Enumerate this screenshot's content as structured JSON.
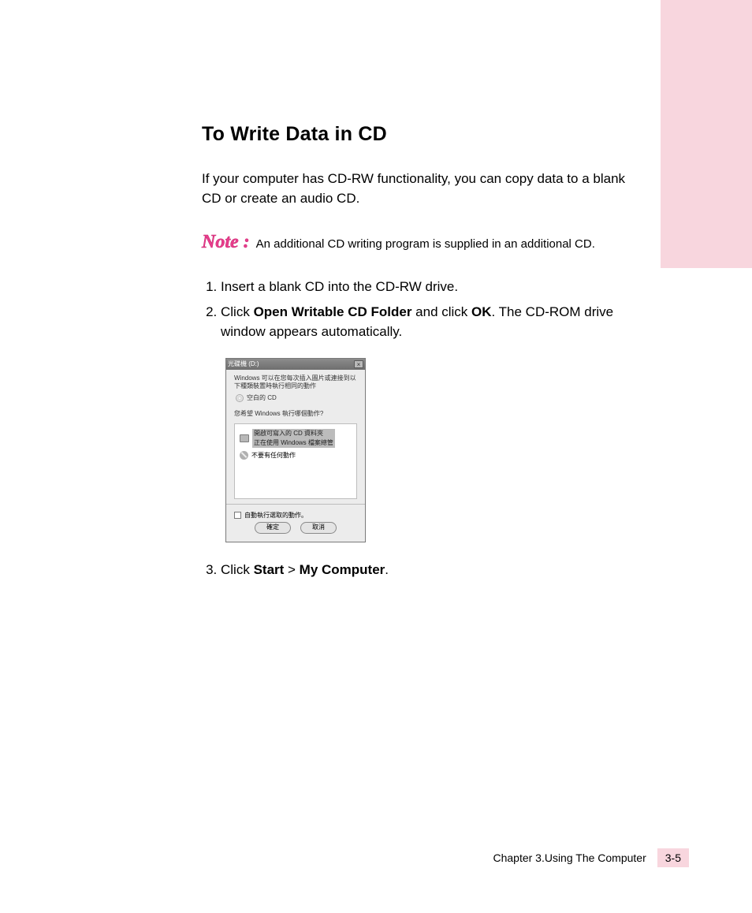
{
  "heading": "To Write Data in CD",
  "intro": "If your computer has CD-RW functionality, you can copy data to a blank CD or create an audio CD.",
  "note": {
    "label": "Note :",
    "text": "An additional CD writing program is supplied in an additional CD."
  },
  "steps": {
    "s1": "Insert a blank CD into the CD-RW drive.",
    "s2a": "Click ",
    "s2b_bold": "Open Writable CD Folder",
    "s2c": " and click ",
    "s2d_bold": "OK",
    "s2e": ". The CD-ROM drive window appears automatically.",
    "s3a": "Click ",
    "s3b_bold": "Start",
    "s3c": " > ",
    "s3d_bold": "My Computer",
    "s3e": "."
  },
  "dialog": {
    "title": "光碟機 (D:)",
    "line1": "Windows 可以在您每次插入圖片或連接到以下種類裝置時執行相同的動作",
    "sub_label": "空白的 CD",
    "question": "您希望 Windows 執行哪個動作?",
    "action_selected_line1": "開啟可寫入的 CD 資料夾",
    "action_selected_line2": "正在使用 Windows 檔案總管",
    "action_none": "不要有任何動作",
    "checkbox": "自動執行選取的動作。",
    "ok": "確定",
    "cancel": "取消"
  },
  "footer": {
    "chapter": "Chapter 3.Using The Computer",
    "page": "3-5"
  }
}
